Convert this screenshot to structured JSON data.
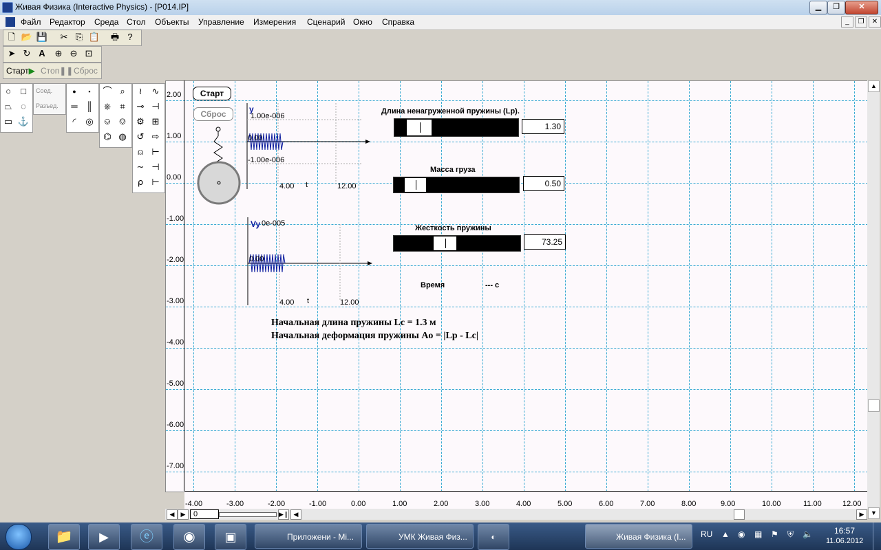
{
  "window": {
    "title": "Живая Физика (Interactive Physics) - [P014.IP]"
  },
  "menu": [
    "Файл",
    "Редактор",
    "Среда",
    "Стол",
    "Объекты",
    "Управление",
    "Измерения",
    "Сценарий",
    "Окно",
    "Справка"
  ],
  "controls": {
    "start": "Старт",
    "stop": "Стоп",
    "reset": "Сброс"
  },
  "palette": {
    "connect": "Соед.",
    "disconnect": "Разъед."
  },
  "sim_buttons": {
    "start": "Старт",
    "reset": "Сброс"
  },
  "graph1": {
    "axis": "y",
    "max": "1.00e-006",
    "mid": "0.00",
    "min": "-1.00e-006",
    "t_min": "4.00",
    "t_label": "t",
    "t_max": "12.00"
  },
  "graph2": {
    "axis": "Vy",
    "max": "0e-005",
    "mid": "0.00",
    "t_min": "4.00",
    "t_label": "t",
    "t_max": "12.00"
  },
  "sliders": [
    {
      "label": "Длина ненагруженной пружины (Lp).",
      "value": "1.30",
      "fraction": 0.12
    },
    {
      "label": "Масса груза",
      "value": "0.50",
      "fraction": 0.1
    },
    {
      "label": "Жесткость пружины",
      "value": "73.25",
      "fraction": 0.38
    }
  ],
  "time": {
    "label": "Время",
    "value": "--- с"
  },
  "notes": [
    "Начальная длина пружины Lc = 1.3 м",
    "Начальная деформация пружины Ao = |Lp - Lc|"
  ],
  "y_axis": [
    "2.00",
    "1.00",
    "0.00",
    "-1.00",
    "-2.00",
    "-3.00",
    "-4.00",
    "-5.00",
    "-6.00",
    "-7.00"
  ],
  "x_axis": [
    "-4.00",
    "-3.00",
    "-2.00",
    "-1.00",
    "0.00",
    "1.00",
    "2.00",
    "3.00",
    "4.00",
    "5.00",
    "6.00",
    "7.00",
    "8.00",
    "9.00",
    "10.00",
    "11.00",
    "12.00"
  ],
  "frame_field": "0",
  "taskbar": {
    "tasks": [
      "Приложени - Mi...",
      "УМК Живая Физ...",
      "Живая Физика (I..."
    ],
    "lang": "RU",
    "time": "16:57",
    "date": "11.06.2012"
  }
}
